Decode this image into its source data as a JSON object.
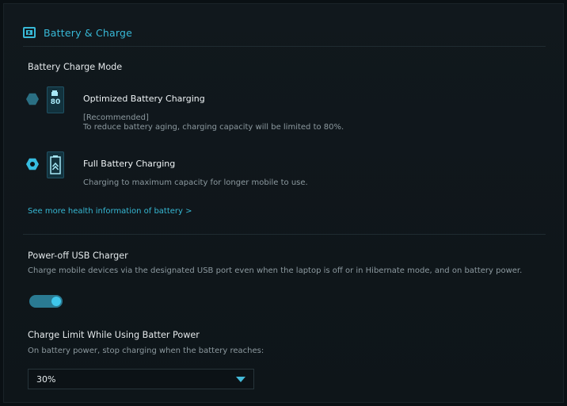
{
  "header": {
    "title": "Battery & Charge"
  },
  "battery_mode": {
    "title": "Battery Charge Mode",
    "options": [
      {
        "selected": false,
        "icon_label": "80",
        "title": "Optimized Battery Charging",
        "desc_line1": "[Recommended]",
        "desc_line2": "To reduce battery aging, charging capacity will be limited to 80%."
      },
      {
        "selected": true,
        "icon_label": "",
        "title": "Full Battery Charging",
        "desc_line1": "Charging to maximum capacity for longer mobile to use.",
        "desc_line2": ""
      }
    ],
    "link_text": "See more health information of battery >"
  },
  "usb_charger": {
    "title": "Power-off USB Charger",
    "desc": "Charge mobile devices via the designated USB port even when the laptop is off or in Hibernate mode, and on battery power.",
    "enabled": true
  },
  "charge_limit": {
    "title": "Charge Limit While Using Batter Power",
    "desc": "On battery power, stop charging when the battery reaches:",
    "value": "30%"
  },
  "colors": {
    "accent": "#36bce0",
    "link": "#36b7d3",
    "text_secondary": "#8c999f"
  }
}
